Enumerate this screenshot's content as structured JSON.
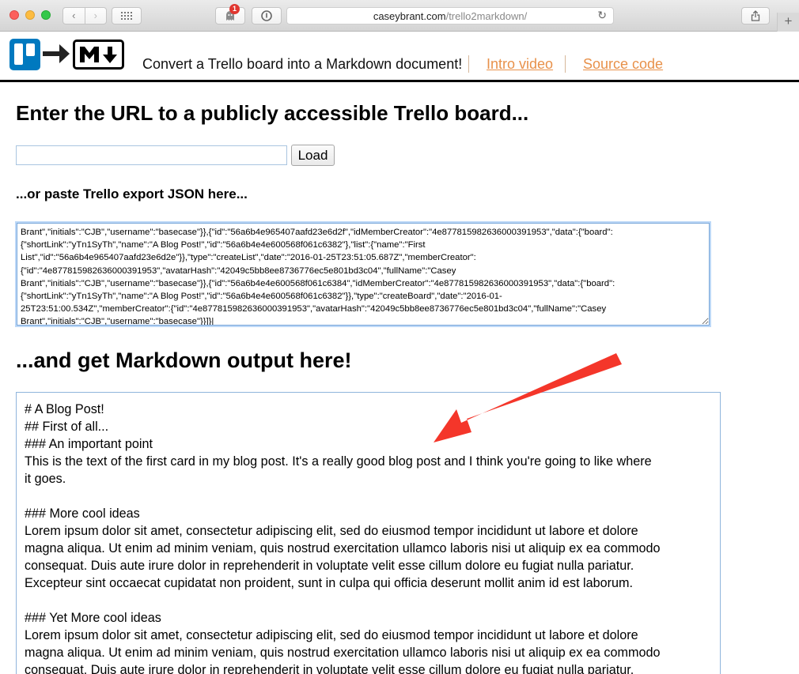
{
  "browser": {
    "url_host": "caseybrant.com",
    "url_path": "/trello2markdown/",
    "ghost_badge": "1",
    "back_glyph": "‹",
    "forward_glyph": "›",
    "reload_glyph": "↻",
    "newtab_glyph": "+"
  },
  "header": {
    "tagline": "Convert a Trello board into a Markdown document!",
    "intro_link": "Intro video",
    "source_link": "Source code",
    "logo_md_text": "M↓",
    "link_color": "#e8914a",
    "trello_color": "#0079bf"
  },
  "main": {
    "heading": "Enter the URL to a publicly accessible Trello board...",
    "url_value": "",
    "load_button": "Load",
    "paste_heading": "...or paste Trello export JSON here...",
    "json_lines": [
      "Brant\",\"initials\":\"CJB\",\"username\":\"basecase\"}},{\"id\":\"56a6b4e965407aafd23e6d2f\",\"idMemberCreator\":\"4e877815982636000391953\",\"data\":{\"board\":",
      "{\"shortLink\":\"yTn1SyTh\",\"name\":\"A Blog Post!\",\"id\":\"56a6b4e4e600568f061c6382\"},\"list\":{\"name\":\"First",
      "List\",\"id\":\"56a6b4e965407aafd23e6d2e\"}},\"type\":\"createList\",\"date\":\"2016-01-25T23:51:05.687Z\",\"memberCreator\":",
      "{\"id\":\"4e877815982636000391953\",\"avatarHash\":\"42049c5bb8ee8736776ec5e801bd3c04\",\"fullName\":\"Casey",
      "Brant\",\"initials\":\"CJB\",\"username\":\"basecase\"}},{\"id\":\"56a6b4e4e600568f061c6384\",\"idMemberCreator\":\"4e877815982636000391953\",\"data\":{\"board\":",
      "{\"shortLink\":\"yTn1SyTh\",\"name\":\"A Blog Post!\",\"id\":\"56a6b4e4e600568f061c6382\"}},\"type\":\"createBoard\",\"date\":\"2016-01-",
      "25T23:51:00.534Z\",\"memberCreator\":{\"id\":\"4e877815982636000391953\",\"avatarHash\":\"42049c5bb8ee8736776ec5e801bd3c04\",\"fullName\":\"Casey",
      "Brant\",\"initials\":\"CJB\",\"username\":\"basecase\"}}]}|"
    ],
    "output_heading": "...and get Markdown output here!",
    "markdown_lines": [
      "# A Blog Post!",
      "## First of all...",
      "### An important point",
      "This is the text of the first card in my blog post. It's a really good blog post and I think you're going to like where",
      "it goes.",
      "",
      "### More cool ideas",
      "Lorem ipsum dolor sit amet, consectetur adipiscing elit, sed do eiusmod tempor incididunt ut labore et dolore",
      "magna aliqua. Ut enim ad minim veniam, quis nostrud exercitation ullamco laboris nisi ut aliquip ex ea commodo",
      "consequat. Duis aute irure dolor in reprehenderit in voluptate velit esse cillum dolore eu fugiat nulla pariatur.",
      "Excepteur sint occaecat cupidatat non proident, sunt in culpa qui officia deserunt mollit anim id est laborum.",
      "",
      "### Yet More cool ideas",
      "Lorem ipsum dolor sit amet, consectetur adipiscing elit, sed do eiusmod tempor incididunt ut labore et dolore",
      "magna aliqua. Ut enim ad minim veniam, quis nostrud exercitation ullamco laboris nisi ut aliquip ex ea commodo",
      "consequat. Duis aute irure dolor in reprehenderit in voluptate velit esse cillum dolore eu fugiat nulla pariatur."
    ]
  },
  "annotation": {
    "arrow_color": "#f4362a"
  }
}
